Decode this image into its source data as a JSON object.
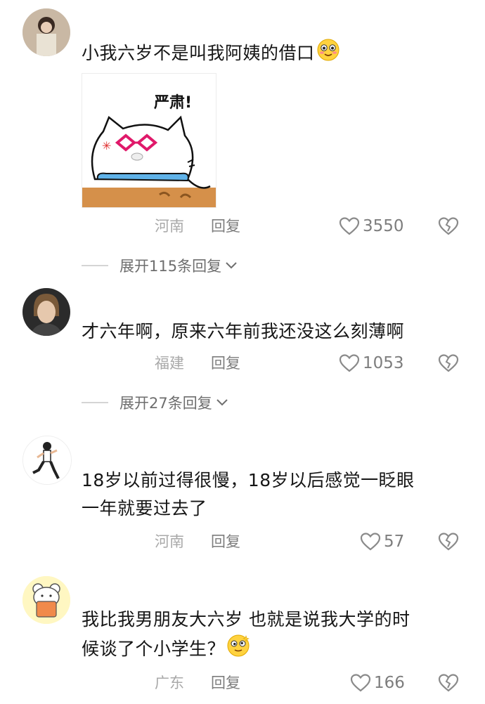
{
  "comments": [
    {
      "text": "小我六岁不是叫我阿姨的借口",
      "emoji": "blushing-smile-emoji",
      "sticker": {
        "caption": "严肃!",
        "icon": "serious-cat-sticker"
      },
      "location": "河南",
      "reply_label": "回复",
      "likes": "3550",
      "expand": "展开115条回复"
    },
    {
      "text": "才六年啊，原来六年前我还没这么刻薄啊",
      "location": "福建",
      "reply_label": "回复",
      "likes": "1053",
      "expand": "展开27条回复"
    },
    {
      "text_line1": "18岁以前过得很慢，18岁以后感觉一眨眼",
      "text_line2": "一年就要过去了",
      "location": "河南",
      "reply_label": "回复",
      "likes": "57"
    },
    {
      "text_line1": "我比我男朋友大六岁  也就是说我大学的时",
      "text_line2": "候谈了个小学生？",
      "emoji": "dizzy-smile-emoji",
      "location": "广东",
      "reply_label": "回复",
      "likes": "166"
    }
  ],
  "colors": {
    "accent_heart": "#888888",
    "meta_gray": "#a9a9a9"
  }
}
